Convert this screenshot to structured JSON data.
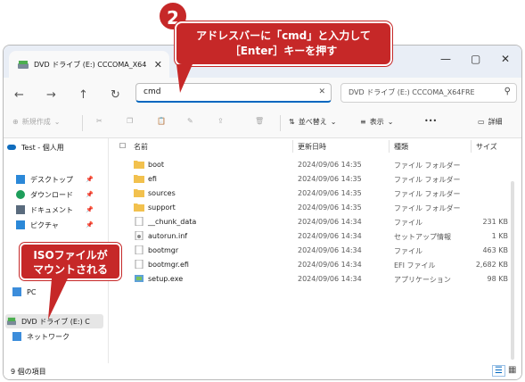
{
  "window": {
    "tab_title": "DVD ドライブ (E:) CCCOMA_X64",
    "tab_close": "✕",
    "new_tab": "+",
    "min": "—",
    "max": "▢",
    "close": "✕"
  },
  "nav": {
    "back": "←",
    "forward": "→",
    "up": "↑",
    "refresh": "↻",
    "address_value": "cmd",
    "address_clear": "✕",
    "search_placeholder": "DVD ドライブ (E:) CCCOMA_X64FRE",
    "search_icon": "⚲"
  },
  "toolbar": {
    "new_label": "新規作成",
    "sort_label": "並べ替え",
    "view_label": "表示",
    "more_label": "•••",
    "details_label": "詳細"
  },
  "sidebar": {
    "items": [
      {
        "label": "Test - 個人用",
        "icon": "cloud-icon"
      },
      {
        "label": "デスクトップ",
        "icon": "desktop-icon"
      },
      {
        "label": "ダウンロード",
        "icon": "download-icon"
      },
      {
        "label": "ドキュメント",
        "icon": "document-icon"
      },
      {
        "label": "ピクチャ",
        "icon": "picture-icon"
      },
      {
        "label": "PC",
        "icon": "pc-icon"
      },
      {
        "label": "DVD ドライブ (E:) C",
        "icon": "dvd-drive-icon"
      },
      {
        "label": "ネットワーク",
        "icon": "network-icon"
      }
    ]
  },
  "columns": {
    "name": "名前",
    "date": "更新日時",
    "type": "種類",
    "size": "サイズ"
  },
  "files": [
    {
      "name": "boot",
      "date": "2024/09/06 14:35",
      "type": "ファイル フォルダー",
      "size": "",
      "icon": "folder-icon"
    },
    {
      "name": "efi",
      "date": "2024/09/06 14:35",
      "type": "ファイル フォルダー",
      "size": "",
      "icon": "folder-icon"
    },
    {
      "name": "sources",
      "date": "2024/09/06 14:35",
      "type": "ファイル フォルダー",
      "size": "",
      "icon": "folder-icon"
    },
    {
      "name": "support",
      "date": "2024/09/06 14:35",
      "type": "ファイル フォルダー",
      "size": "",
      "icon": "folder-icon"
    },
    {
      "name": "__chunk_data",
      "date": "2024/09/06 14:34",
      "type": "ファイル",
      "size": "231 KB",
      "icon": "file-icon"
    },
    {
      "name": "autorun.inf",
      "date": "2024/09/06 14:34",
      "type": "セットアップ情報",
      "size": "1 KB",
      "icon": "setup-info-icon"
    },
    {
      "name": "bootmgr",
      "date": "2024/09/06 14:34",
      "type": "ファイル",
      "size": "463 KB",
      "icon": "file-icon"
    },
    {
      "name": "bootmgr.efi",
      "date": "2024/09/06 14:34",
      "type": "EFI ファイル",
      "size": "2,682 KB",
      "icon": "file-icon"
    },
    {
      "name": "setup.exe",
      "date": "2024/09/06 14:34",
      "type": "アプリケーション",
      "size": "98 KB",
      "icon": "setup-exe-icon"
    }
  ],
  "status": {
    "item_count": "9 個の項目"
  },
  "annotations": {
    "badge_number": "2",
    "callout_top_line1": "アドレスバーに「cmd」と入力して",
    "callout_top_line2": "［Enter］キーを押す",
    "callout_left_line1": "ISOファイルが",
    "callout_left_line2": "マウントされる"
  },
  "colors": {
    "accent_red": "#c62828",
    "folder": "#f2c14e",
    "address_underline": "#0067c0"
  }
}
